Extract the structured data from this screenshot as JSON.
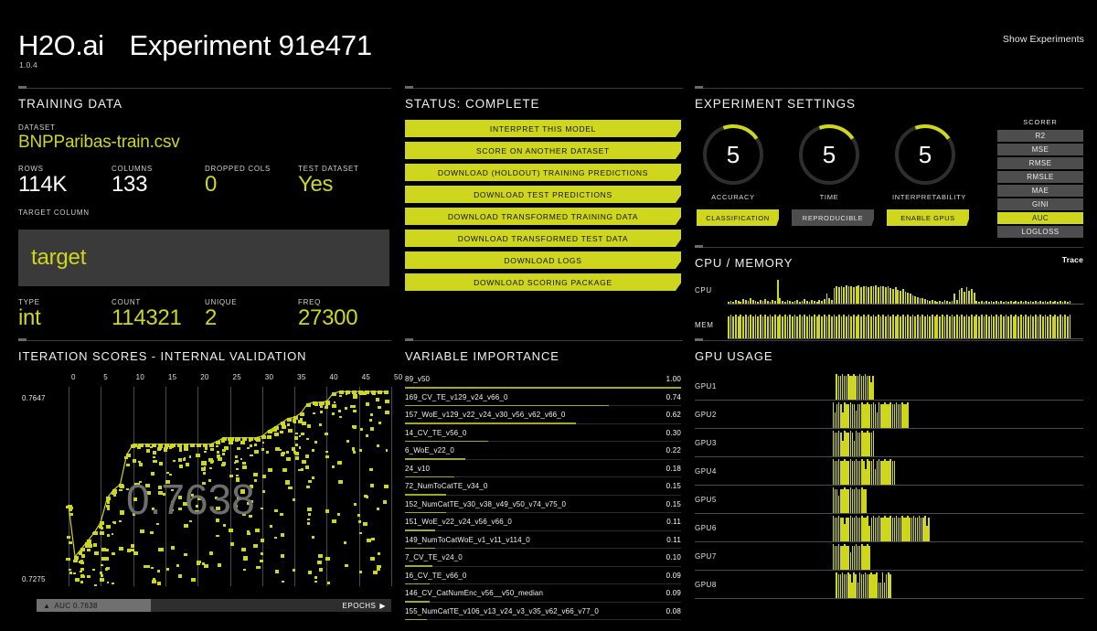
{
  "header": {
    "brand": "H2O.ai",
    "experiment_title": "Experiment 91e471",
    "version": "1.0.4",
    "show_experiments": "Show Experiments"
  },
  "training_data": {
    "title": "TRAINING DATA",
    "dataset_label": "DATASET",
    "dataset_value": "BNPParibas-train.csv",
    "stats": [
      {
        "label": "ROWS",
        "value": "114K",
        "accent": false
      },
      {
        "label": "COLUMNS",
        "value": "133",
        "accent": false
      },
      {
        "label": "DROPPED COLS",
        "value": "0",
        "accent": true
      },
      {
        "label": "TEST DATASET",
        "value": "Yes",
        "accent": true
      }
    ],
    "target_label": "TARGET COLUMN",
    "target_value": "target",
    "target_stats": [
      {
        "label": "TYPE",
        "value": "int"
      },
      {
        "label": "COUNT",
        "value": "114321"
      },
      {
        "label": "UNIQUE",
        "value": "2"
      },
      {
        "label": "FREQ",
        "value": "27300"
      }
    ]
  },
  "status": {
    "title": "STATUS: COMPLETE",
    "buttons": [
      "INTERPRET THIS MODEL",
      "SCORE ON ANOTHER DATASET",
      "DOWNLOAD (HOLDOUT) TRAINING PREDICTIONS",
      "DOWNLOAD TEST PREDICTIONS",
      "DOWNLOAD TRANSFORMED TRAINING DATA",
      "DOWNLOAD TRANSFORMED TEST DATA",
      "DOWNLOAD LOGS",
      "DOWNLOAD SCORING PACKAGE"
    ]
  },
  "settings": {
    "title": "EXPERIMENT SETTINGS",
    "dials": [
      {
        "value": "5",
        "label": "ACCURACY"
      },
      {
        "value": "5",
        "label": "TIME"
      },
      {
        "value": "5",
        "label": "INTERPRETABILITY"
      }
    ],
    "toggles": [
      {
        "label": "CLASSIFICATION",
        "on": true
      },
      {
        "label": "REPRODUCIBLE",
        "on": false
      },
      {
        "label": "ENABLE GPUS",
        "on": true
      }
    ],
    "scorer_label": "SCORER",
    "scorers": [
      {
        "name": "R2",
        "selected": false
      },
      {
        "name": "MSE",
        "selected": false
      },
      {
        "name": "RMSE",
        "selected": false
      },
      {
        "name": "RMSLE",
        "selected": false
      },
      {
        "name": "MAE",
        "selected": false
      },
      {
        "name": "GINI",
        "selected": false
      },
      {
        "name": "AUC",
        "selected": true
      },
      {
        "name": "LOGLOSS",
        "selected": false
      }
    ]
  },
  "cpu_memory": {
    "title": "CPU / MEMORY",
    "trace_label": "Trace",
    "rows": [
      {
        "label": "CPU"
      },
      {
        "label": "MEM"
      }
    ]
  },
  "iteration_scores": {
    "title": "ITERATION SCORES - INTERNAL VALIDATION",
    "y_max_label": "0.7647",
    "y_min_label": "0.7275",
    "big_score": "0.7638",
    "auc_chip": "AUC 0.7638",
    "epochs_label": "EPOCHS",
    "x_ticks": [
      "0",
      "5",
      "10",
      "15",
      "20",
      "25",
      "30",
      "35",
      "40",
      "45",
      "50"
    ]
  },
  "variable_importance": {
    "title": "VARIABLE IMPORTANCE",
    "rows": [
      {
        "name": "89_v50",
        "value": "1.00"
      },
      {
        "name": "169_CV_TE_v129_v24_v66_0",
        "value": "0.74"
      },
      {
        "name": "157_WoE_v129_v22_v24_v30_v56_v62_v66_0",
        "value": "0.62"
      },
      {
        "name": "14_CV_TE_v56_0",
        "value": "0.30"
      },
      {
        "name": "6_WoE_v22_0",
        "value": "0.22"
      },
      {
        "name": "24_v10",
        "value": "0.18"
      },
      {
        "name": "72_NumToCatTE_v34_0",
        "value": "0.15"
      },
      {
        "name": "152_NumCatTE_v30_v38_v49_v50_v74_v75_0",
        "value": "0.15"
      },
      {
        "name": "151_WoE_v22_v24_v56_v66_0",
        "value": "0.11"
      },
      {
        "name": "149_NumToCatWoE_v1_v11_v114_0",
        "value": "0.11"
      },
      {
        "name": "7_CV_TE_v24_0",
        "value": "0.10"
      },
      {
        "name": "16_CV_TE_v66_0",
        "value": "0.09"
      },
      {
        "name": "146_CV_CatNumEnc_v56__v50_median",
        "value": "0.09"
      },
      {
        "name": "155_NumCatTE_v106_v13_v24_v3_v35_v62_v66_v77_0",
        "value": "0.08"
      }
    ]
  },
  "gpu_usage": {
    "title": "GPU USAGE",
    "rows": [
      {
        "label": "GPU1"
      },
      {
        "label": "GPU2"
      },
      {
        "label": "GPU3"
      },
      {
        "label": "GPU4"
      },
      {
        "label": "GPU5"
      },
      {
        "label": "GPU6"
      },
      {
        "label": "GPU7"
      },
      {
        "label": "GPU8"
      }
    ]
  },
  "chart_data": [
    {
      "type": "scatter",
      "name": "iteration-scores",
      "title": "ITERATION SCORES - INTERNAL VALIDATION",
      "xlabel": "EPOCHS",
      "ylabel": "AUC",
      "xlim": [
        0,
        50
      ],
      "ylim": [
        0.7275,
        0.7647
      ],
      "best_score": 0.7638,
      "grid": true,
      "x_ticks": [
        0,
        5,
        10,
        15,
        20,
        25,
        30,
        35,
        40,
        45,
        50
      ],
      "y_ticks": [
        0.7275,
        0.7647
      ],
      "best_curve": [
        [
          0,
          0.7425
        ],
        [
          1,
          0.733
        ],
        [
          2,
          0.7345
        ],
        [
          3,
          0.736
        ],
        [
          4,
          0.7375
        ],
        [
          5,
          0.7395
        ],
        [
          6,
          0.744
        ],
        [
          7,
          0.7455
        ],
        [
          8,
          0.7465
        ],
        [
          9,
          0.752
        ],
        [
          10,
          0.754
        ],
        [
          11,
          0.754
        ],
        [
          12,
          0.754
        ],
        [
          13,
          0.754
        ],
        [
          14,
          0.754
        ],
        [
          15,
          0.754
        ],
        [
          16,
          0.754
        ],
        [
          17,
          0.754
        ],
        [
          18,
          0.754
        ],
        [
          19,
          0.754
        ],
        [
          20,
          0.754
        ],
        [
          21,
          0.754
        ],
        [
          22,
          0.754
        ],
        [
          23,
          0.7545
        ],
        [
          24,
          0.7552
        ],
        [
          25,
          0.7552
        ],
        [
          26,
          0.7552
        ],
        [
          27,
          0.7552
        ],
        [
          28,
          0.7552
        ],
        [
          29,
          0.7552
        ],
        [
          30,
          0.7555
        ],
        [
          31,
          0.7565
        ],
        [
          32,
          0.7572
        ],
        [
          33,
          0.758
        ],
        [
          34,
          0.7588
        ],
        [
          35,
          0.759
        ],
        [
          36,
          0.7598
        ],
        [
          37,
          0.7615
        ],
        [
          38,
          0.7618
        ],
        [
          39,
          0.7618
        ],
        [
          40,
          0.762
        ],
        [
          41,
          0.7635
        ],
        [
          42,
          0.7638
        ],
        [
          43,
          0.7638
        ],
        [
          44,
          0.7638
        ],
        [
          45,
          0.7638
        ],
        [
          46,
          0.7638
        ],
        [
          47,
          0.7638
        ],
        [
          48,
          0.7638
        ],
        [
          49,
          0.7638
        ]
      ]
    },
    {
      "type": "bar",
      "name": "variable-importance",
      "title": "VARIABLE IMPORTANCE",
      "categories": [
        "89_v50",
        "169_CV_TE_v129_v24_v66_0",
        "157_WoE_v129_v22_v24_v30_v56_v62_v66_0",
        "14_CV_TE_v56_0",
        "6_WoE_v22_0",
        "24_v10",
        "72_NumToCatTE_v34_0",
        "152_NumCatTE_v30_v38_v49_v50_v74_v75_0",
        "151_WoE_v22_v24_v56_v66_0",
        "149_NumToCatWoE_v1_v11_v114_0",
        "7_CV_TE_v24_0",
        "16_CV_TE_v66_0",
        "146_CV_CatNumEnc_v56__v50_median",
        "155_NumCatTE_v106_v13_v24_v3_v35_v62_v66_v77_0"
      ],
      "values": [
        1.0,
        0.74,
        0.62,
        0.3,
        0.22,
        0.18,
        0.15,
        0.15,
        0.11,
        0.11,
        0.1,
        0.09,
        0.09,
        0.08
      ],
      "xlim": [
        0,
        1
      ],
      "ylabel": "importance"
    },
    {
      "type": "area",
      "name": "cpu-memory",
      "title": "CPU / MEMORY",
      "series": [
        {
          "name": "CPU",
          "values": [
            2,
            3,
            2,
            4,
            3,
            2,
            5,
            4,
            3,
            6,
            4,
            3,
            2,
            4,
            3,
            5,
            3,
            2,
            4,
            3,
            28,
            6,
            3,
            2,
            4,
            3,
            2,
            3,
            4,
            2,
            3,
            5,
            3,
            2,
            4,
            3,
            2,
            4,
            3,
            5,
            12,
            6,
            4,
            18,
            20,
            19,
            21,
            19,
            22,
            20,
            21,
            19,
            20,
            22,
            19,
            21,
            20,
            19,
            21,
            20,
            22,
            19,
            20,
            21,
            19,
            20,
            18,
            17,
            19,
            16,
            15,
            17,
            14,
            13,
            12,
            10,
            9,
            8,
            7,
            6,
            5,
            4,
            3,
            4,
            3,
            2,
            3,
            2,
            4,
            3,
            2,
            3,
            12,
            4,
            16,
            18,
            14,
            19,
            15,
            17,
            13,
            3,
            2,
            3,
            2,
            3,
            2,
            3,
            2,
            3,
            2,
            3,
            2,
            3,
            2,
            3,
            2,
            3,
            2,
            3,
            2,
            3,
            2,
            3,
            2,
            3,
            2,
            3,
            2,
            3,
            2,
            3,
            2,
            3,
            2,
            3,
            2,
            3,
            2,
            3
          ]
        },
        {
          "name": "MEM",
          "values": [
            14,
            15,
            14,
            15,
            14,
            15,
            14,
            15,
            14,
            15,
            14,
            15,
            14,
            15,
            14,
            15,
            14,
            15,
            14,
            15,
            14,
            15,
            14,
            15,
            14,
            15,
            14,
            15,
            14,
            15,
            14,
            15,
            14,
            15,
            14,
            15,
            14,
            15,
            14,
            15,
            14,
            15,
            14,
            15,
            14,
            15,
            14,
            15,
            14,
            15,
            14,
            15,
            14,
            15,
            14,
            15,
            14,
            15,
            14,
            15,
            14,
            15,
            14,
            15,
            14,
            15,
            14,
            15,
            14,
            15,
            14,
            15,
            14,
            15,
            14,
            15,
            14,
            15,
            14,
            15,
            14,
            15,
            14,
            15,
            14,
            15,
            14,
            15,
            14,
            15,
            14,
            15,
            14,
            15,
            14,
            15,
            14,
            15,
            14,
            15,
            14,
            15,
            14,
            15,
            14,
            15,
            14,
            15,
            14,
            15,
            14,
            15,
            14,
            15,
            14,
            15,
            14,
            15,
            14,
            15,
            14,
            15,
            14,
            15,
            14,
            15,
            14,
            15,
            14,
            15,
            14,
            15,
            14,
            15,
            14,
            15,
            14,
            15,
            14,
            15
          ]
        }
      ]
    },
    {
      "type": "bar",
      "name": "gpu-usage",
      "title": "GPU USAGE",
      "series": [
        {
          "name": "GPU1",
          "start": 0.29,
          "end": 0.4,
          "level": 1.0
        },
        {
          "name": "GPU2",
          "start": 0.28,
          "end": 0.5,
          "level": 1.0
        },
        {
          "name": "GPU3",
          "start": 0.28,
          "end": 0.4,
          "level": 1.0
        },
        {
          "name": "GPU4",
          "start": 0.28,
          "end": 0.46,
          "level": 1.0
        },
        {
          "name": "GPU5",
          "start": 0.28,
          "end": 0.38,
          "level": 1.0
        },
        {
          "name": "GPU6",
          "start": 0.28,
          "end": 0.56,
          "level": 1.0
        },
        {
          "name": "GPU7",
          "start": 0.28,
          "end": 0.39,
          "level": 1.0
        },
        {
          "name": "GPU8",
          "start": 0.29,
          "end": 0.45,
          "level": 1.0
        }
      ]
    }
  ],
  "colors": {
    "accent": "#cfd61e",
    "background": "#000000",
    "panel_gray": "#3a3a3a",
    "button_gray": "#4d4d4d",
    "text": "#ffffff"
  }
}
